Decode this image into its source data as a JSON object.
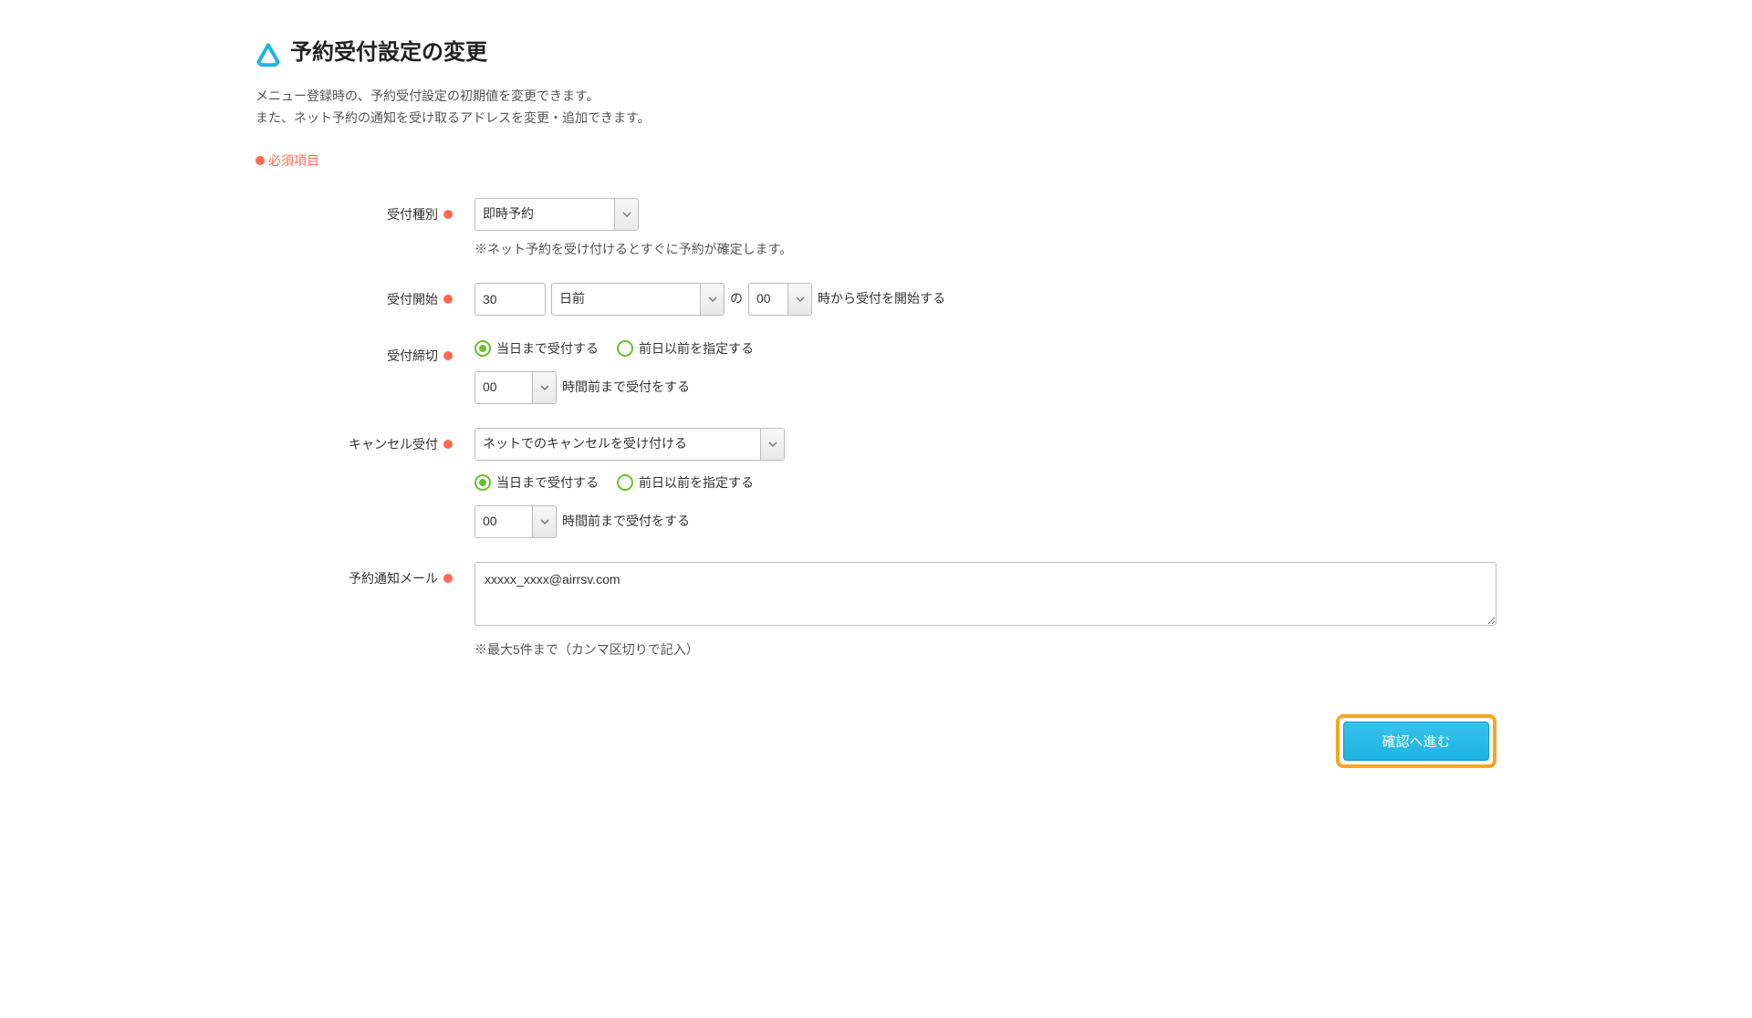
{
  "page": {
    "title": "予約受付設定の変更",
    "description_line1": "メニュー登録時の、予約受付設定の初期値を変更できます。",
    "description_line2": "また、ネット予約の通知を受け取るアドレスを変更・追加できます。",
    "required_legend": "必須項目"
  },
  "fields": {
    "reception_type": {
      "label": "受付種別",
      "value": "即時予約",
      "hint": "※ネット予約を受け付けるとすぐに予約が確定します。"
    },
    "reception_start": {
      "label": "受付開始",
      "days_value": "30",
      "unit_value": "日前",
      "connector": "の",
      "hour_value": "00",
      "suffix": "時から受付を開始する"
    },
    "reception_deadline": {
      "label": "受付締切",
      "radio_options": [
        {
          "label": "当日まで受付する",
          "checked": true
        },
        {
          "label": "前日以前を指定する",
          "checked": false
        }
      ],
      "hours_value": "00",
      "hours_suffix": "時間前まで受付をする"
    },
    "cancel_reception": {
      "label": "キャンセル受付",
      "select_value": "ネットでのキャンセルを受け付ける",
      "radio_options": [
        {
          "label": "当日まで受付する",
          "checked": true
        },
        {
          "label": "前日以前を指定する",
          "checked": false
        }
      ],
      "hours_value": "00",
      "hours_suffix": "時間前まで受付をする"
    },
    "notify_email": {
      "label": "予約通知メール",
      "value": "xxxxx_xxxx@airrsv.com",
      "hint": "※最大5件まで（カンマ区切りで記入）"
    }
  },
  "actions": {
    "confirm_label": "確認へ進む"
  }
}
